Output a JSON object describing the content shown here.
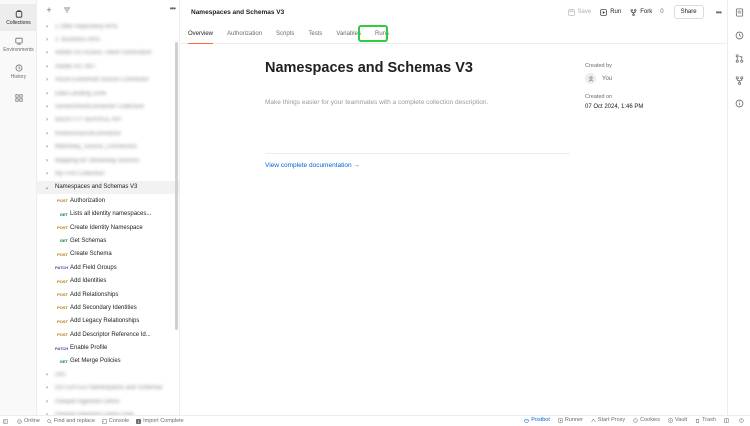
{
  "rail": {
    "items": [
      {
        "label": "Collections",
        "icon": "collections-icon",
        "active": true
      },
      {
        "label": "Environments",
        "icon": "environments-icon",
        "active": false
      },
      {
        "label": "History",
        "icon": "history-icon",
        "active": false
      },
      {
        "label": "",
        "icon": "apps-grid-icon",
        "active": false
      }
    ]
  },
  "sidebar": {
    "collections_before": [
      "1 Offer Repository APIs",
      "2. Business APIs",
      "Adobe I/O Access Token Generation",
      "Adobe I/O JWT",
      "Azure EventHub Source Connector",
      "Data Landing Zone",
      "GenericRestConnector Collection",
      "IDENTITY SERVICE API",
      "KinesisSourceConnector",
      "Matchkey_Source_Connectors",
      "Mapping for Streaming Sources",
      "My First Collection"
    ],
    "expanded": {
      "name": "Namespaces and Schemas V3",
      "requests": [
        {
          "method": "POST",
          "name": "Authorization"
        },
        {
          "method": "GET",
          "name": "Lists all identity namespaces..."
        },
        {
          "method": "POST",
          "name": "Create Identity Namespace"
        },
        {
          "method": "GET",
          "name": "Get Schemas"
        },
        {
          "method": "POST",
          "name": "Create Schema"
        },
        {
          "method": "PATCH",
          "name": "Add Field Groups"
        },
        {
          "method": "POST",
          "name": "Add Identities"
        },
        {
          "method": "POST",
          "name": "Add Relationships"
        },
        {
          "method": "POST",
          "name": "Add Secondary Identities"
        },
        {
          "method": "POST",
          "name": "Add Legacy Relationships"
        },
        {
          "method": "POST",
          "name": "Add Descriptor Reference Id..."
        },
        {
          "method": "PATCH",
          "name": "Enable Profile"
        },
        {
          "method": "GET",
          "name": "Get Merge Policies"
        }
      ]
    },
    "collections_after": [
      "OIS",
      "OUTDATED Namespaces and Schemas",
      "Parquet Ingestion Demo",
      "Parquet Ingestion Demo copy"
    ]
  },
  "header": {
    "title": "Namespaces and Schemas V3",
    "save_label": "Save",
    "run_label": "Run",
    "fork_label": "Fork",
    "fork_count": "0",
    "share_label": "Share"
  },
  "tabs": [
    "Overview",
    "Authorization",
    "Scripts",
    "Tests",
    "Variables",
    "Runs"
  ],
  "overview": {
    "title": "Namespaces and Schemas V3",
    "description_placeholder": "Make things easier for your teammates with a complete collection description.",
    "doc_link": "View complete documentation →",
    "created_by_label": "Created by",
    "created_by": "You",
    "created_on_label": "Created on",
    "created_on": "07 Oct 2024, 1:46 PM"
  },
  "status_bar": {
    "left": [
      "Online",
      "Find and replace",
      "Console",
      "Import Complete"
    ],
    "right": [
      "Postbot",
      "Runner",
      "Start Proxy",
      "Cookies",
      "Vault",
      "Trash"
    ]
  },
  "colors": {
    "accent": "#ff6c37",
    "link": "#0265d2",
    "highlight": "#2ecc40",
    "post": "#ad7a03",
    "get": "#007f31",
    "patch": "#623497"
  }
}
